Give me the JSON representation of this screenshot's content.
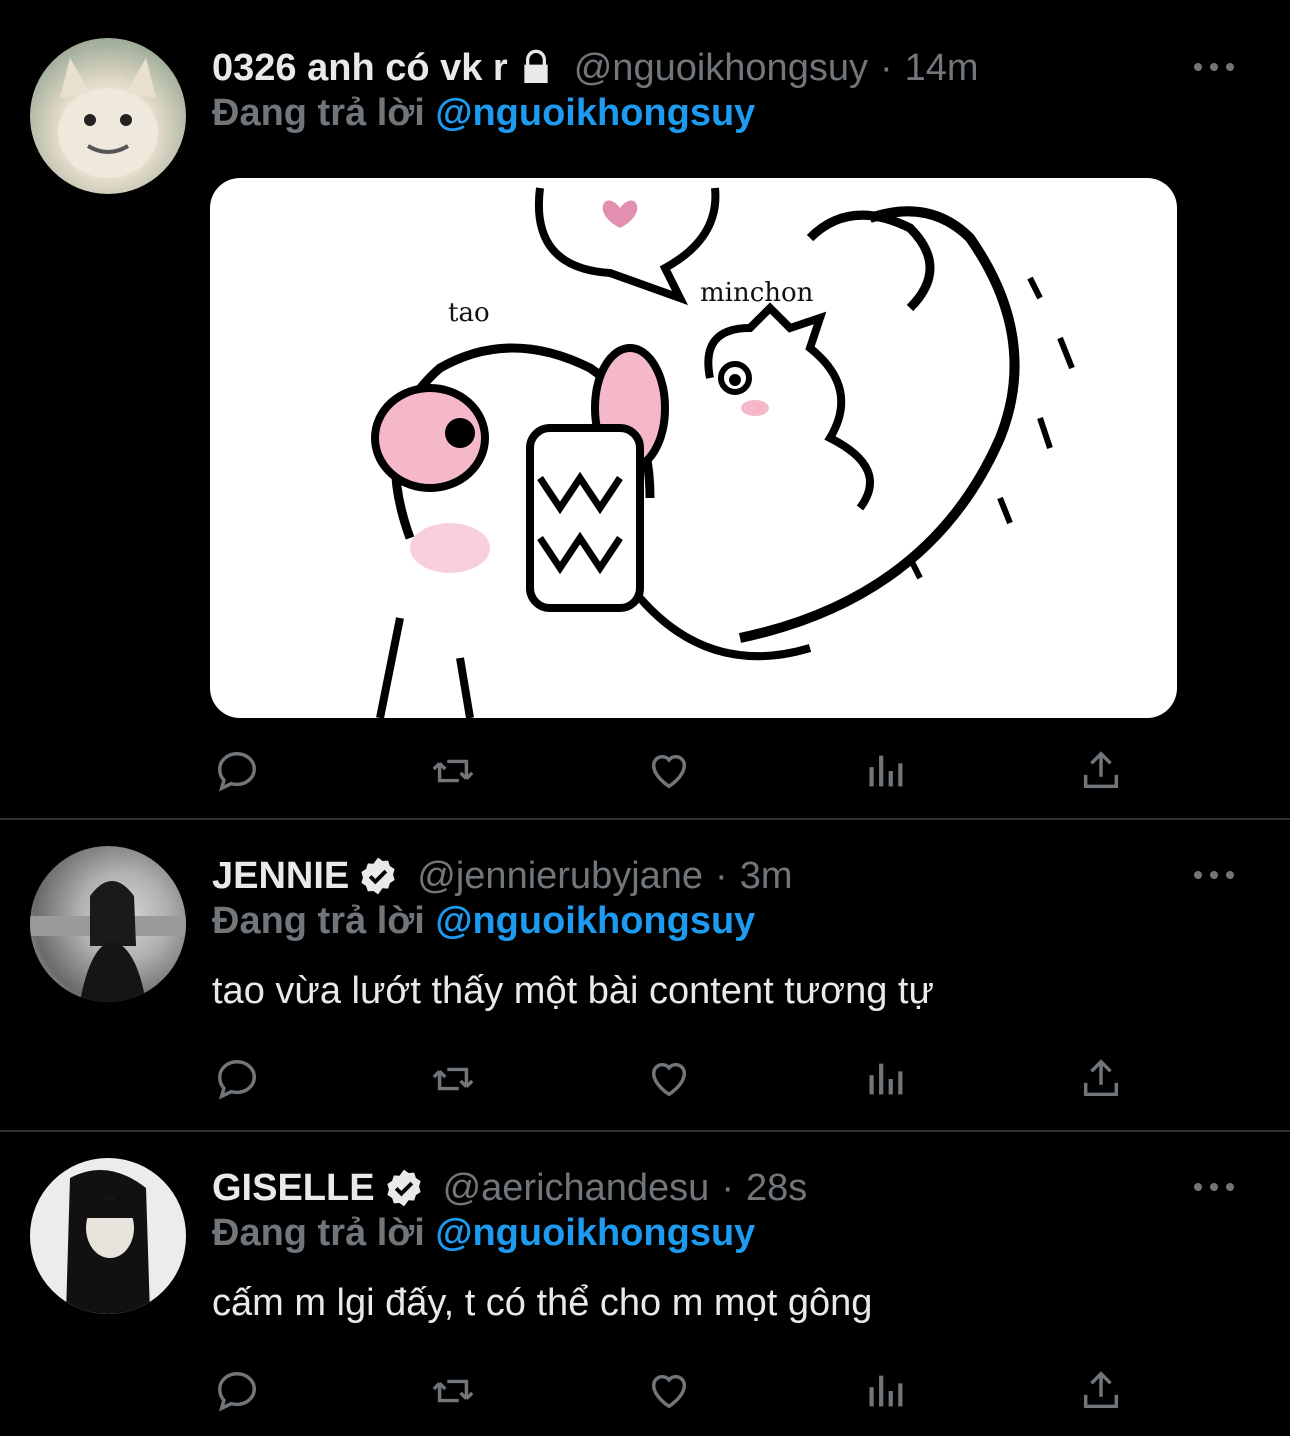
{
  "reply_prefix": "Đang trả lời",
  "tweets": [
    {
      "name": "0326 anh có vk r",
      "handle": "@nguoikhongsuy",
      "time": "14m",
      "badge": "lock-icon",
      "reply_to": "@nguoikhongsuy",
      "text": "",
      "media": {
        "label_left": "tao",
        "label_right": "minchon"
      }
    },
    {
      "name": "JENNIE",
      "handle": "@jennierubyjane",
      "time": "3m",
      "badge": "verified-icon",
      "reply_to": "@nguoikhongsuy",
      "text": "tao vừa lướt thấy một bài content tương tự"
    },
    {
      "name": "GISELLE",
      "handle": "@aerichandesu",
      "time": "28s",
      "badge": "verified-icon",
      "reply_to": "@nguoikhongsuy",
      "text": "cấm m lgi đấy, t có thể cho m mọt gông"
    }
  ],
  "separator": "·",
  "colors": {
    "background": "#000000",
    "text": "#e7e9ea",
    "muted": "#71767b",
    "accent": "#1d9bf0",
    "divider": "#2f3336"
  }
}
